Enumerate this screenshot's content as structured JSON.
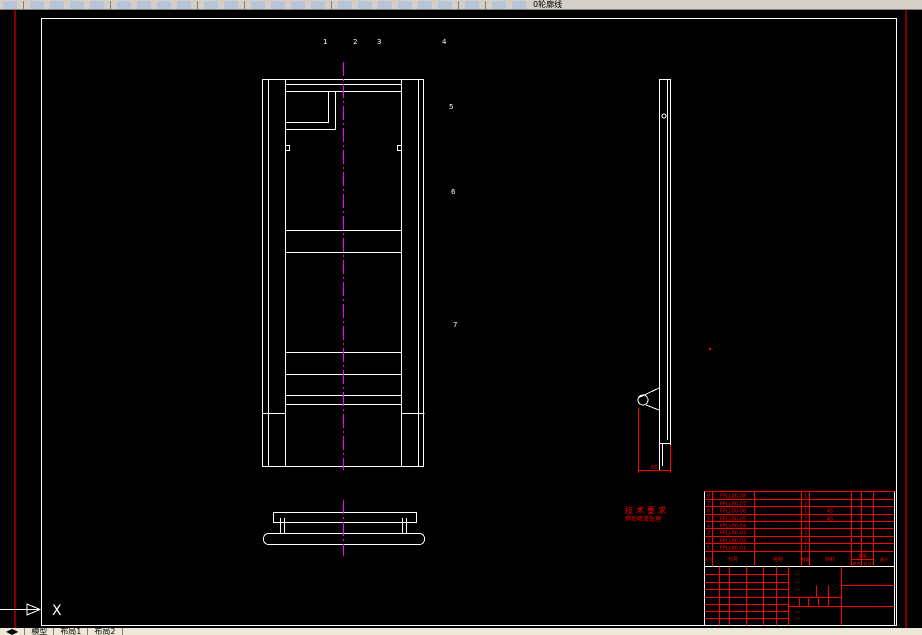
{
  "toolbar": {
    "layer_name": "0轮廓线"
  },
  "tabs": [
    "模型",
    "布局1",
    "布局2"
  ],
  "drawing": {
    "balloons_top": [
      "1",
      "2",
      "3",
      "4"
    ],
    "balloons_right": [
      "5",
      "6",
      "7"
    ],
    "dimension": "65",
    "tech_req_title": "技术要求",
    "tech_req_text": "焊后喷漆处理",
    "ucs_axis": "X"
  },
  "title_block": {
    "parts": [
      {
        "no": "8",
        "code": "FPLJ-00-08",
        "name": "",
        "qty": "1",
        "material": ""
      },
      {
        "no": "7",
        "code": "FPLJ-00-07",
        "name": "",
        "qty": "2",
        "material": ""
      },
      {
        "no": "6",
        "code": "FPLJ-00-06",
        "name": "",
        "qty": "1",
        "material": "45"
      },
      {
        "no": "5",
        "code": "FPLJ-00-05",
        "name": "",
        "qty": "2",
        "material": "45"
      },
      {
        "no": "4",
        "code": "FPLJ-00-04",
        "name": "",
        "qty": "2",
        "material": ""
      },
      {
        "no": "3",
        "code": "FPLJ-00-03",
        "name": "",
        "qty": "2",
        "material": ""
      },
      {
        "no": "2",
        "code": "FPLJ-00-02",
        "name": "",
        "qty": "2",
        "material": ""
      },
      {
        "no": "1",
        "code": "FPLJ-00-01",
        "name": "",
        "qty": "1",
        "material": ""
      }
    ],
    "headers": {
      "no": "序号",
      "code": "代号",
      "name": "名称",
      "qty": "数量",
      "material": "材料",
      "unit": "单件",
      "total": "总计",
      "weight": "重量",
      "remark": "备注"
    },
    "drawing_name": "",
    "colors": {
      "frame": "#ffffff",
      "block": "#ff0000",
      "centerline": "#ff00ff"
    }
  }
}
